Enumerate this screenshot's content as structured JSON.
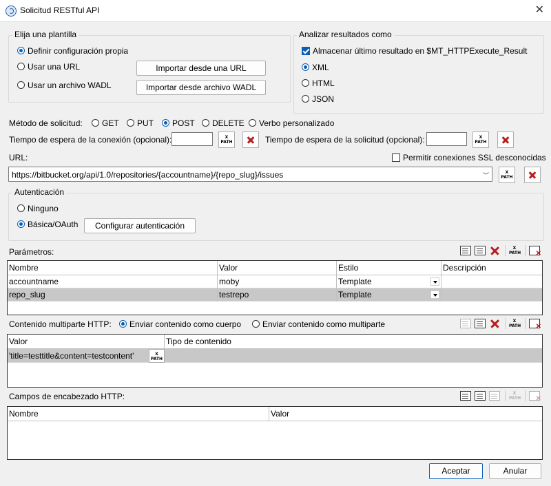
{
  "window": {
    "title": "Solicitud RESTful API",
    "close_label": "✕"
  },
  "template_group": {
    "title": "Elija una plantilla",
    "options": [
      {
        "label": "Definir configuración propia",
        "selected": true
      },
      {
        "label": "Usar una URL",
        "selected": false
      },
      {
        "label": "Usar un archivo WADL",
        "selected": false
      }
    ],
    "import_url_button": "Importar desde una URL",
    "import_wadl_button": "Importar desde archivo WADL"
  },
  "results_group": {
    "title": "Analizar resultados como",
    "store_checkbox": {
      "label": "Almacenar último resultado en $MT_HTTPExecute_Result",
      "checked": true
    },
    "formats": [
      {
        "label": "XML",
        "selected": true
      },
      {
        "label": "HTML",
        "selected": false
      },
      {
        "label": "JSON",
        "selected": false
      }
    ]
  },
  "method": {
    "label": "Método de solicitud:",
    "options": [
      {
        "label": "GET",
        "selected": false
      },
      {
        "label": "PUT",
        "selected": false
      },
      {
        "label": "POST",
        "selected": true
      },
      {
        "label": "DELETE",
        "selected": false
      },
      {
        "label": "Verbo personalizado",
        "selected": false
      }
    ]
  },
  "timeouts": {
    "connection_label": "Tiempo de espera de la conexión (opcional):",
    "connection_value": "",
    "request_label": "Tiempo de espera de la solicitud (opcional):",
    "request_value": ""
  },
  "xpath_label": {
    "top": "X",
    "bottom": "PATH"
  },
  "url": {
    "label": "URL:",
    "value": "https://bitbucket.org/api/1.0/repositories/{accountname}/{repo_slug}/issues",
    "ssl_checkbox": {
      "label": "Permitir conexiones SSL desconocidas",
      "checked": false
    }
  },
  "auth": {
    "title": "Autenticación",
    "options": [
      {
        "label": "Ninguno",
        "selected": false
      },
      {
        "label": "Básica/OAuth",
        "selected": true
      }
    ],
    "configure_button": "Configurar autenticación"
  },
  "parameters": {
    "label": "Parámetros:",
    "columns": [
      "Nombre",
      "Valor",
      "Estilo",
      "Descripción"
    ],
    "rows": [
      {
        "name": "accountname",
        "value": "moby",
        "style": "Template",
        "description": "",
        "selected": false
      },
      {
        "name": "repo_slug",
        "value": "testrepo",
        "style": "Template",
        "description": "",
        "selected": true
      }
    ]
  },
  "multipart": {
    "label": "Contenido multiparte HTTP:",
    "options": [
      {
        "label": "Enviar contenido como cuerpo",
        "selected": true
      },
      {
        "label": "Enviar contenido como multiparte",
        "selected": false
      }
    ],
    "columns": [
      "Valor",
      "Tipo de contenido"
    ],
    "rows": [
      {
        "value": "'title=testtitle&content=testcontent'",
        "content_type": ""
      }
    ]
  },
  "headers": {
    "label": "Campos de encabezado HTTP:",
    "columns": [
      "Nombre",
      "Valor"
    ],
    "rows": []
  },
  "footer": {
    "ok_button": "Aceptar",
    "cancel_button": "Anular"
  }
}
